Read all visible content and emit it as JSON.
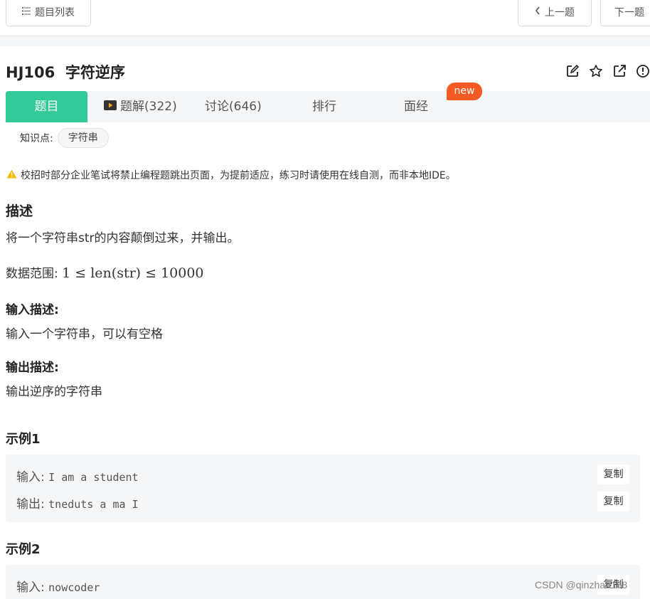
{
  "topbar": {
    "list_label": "题目列表",
    "prev_label": "上一题",
    "next_label": "下一题"
  },
  "problem": {
    "title": "HJ106  字符逆序"
  },
  "title_icons": [
    "edit-icon",
    "star-icon",
    "external-link-icon",
    "report-icon"
  ],
  "tabs": [
    {
      "label": "题目",
      "active": true
    },
    {
      "label": "题解(322)",
      "icon": "video-icon"
    },
    {
      "label": "讨论(646)"
    },
    {
      "label": "排行"
    },
    {
      "label": "面经",
      "badge": "new"
    }
  ],
  "knowledge": {
    "label": "知识点:",
    "tag": "字符串"
  },
  "warning": "校招时部分企业笔试将禁止编程题跳出页面，为提前适应，练习时请使用在线自测，而非本地IDE。",
  "description": {
    "heading": "描述",
    "text": "将一个字符串str的内容颠倒过来，并输出。",
    "range_label": "数据范围:",
    "range_formula": "1 ≤ len(str) ≤ 10000"
  },
  "input_desc": {
    "heading": "输入描述:",
    "text": "输入一个字符串，可以有空格"
  },
  "output_desc": {
    "heading": "输出描述:",
    "text": "输出逆序的字符串"
  },
  "examples": [
    {
      "heading": "示例1",
      "input_label": "输入:",
      "input": "I am a student",
      "output_label": "输出:",
      "output": "tneduts a ma I",
      "copy_label": "复制"
    },
    {
      "heading": "示例2",
      "input_label": "输入:",
      "input": "nowcoder",
      "copy_label": "复制"
    }
  ],
  "watermark": "CSDN @qinzhao168",
  "colors": {
    "accent": "#32ca99",
    "badge": "#f55a25",
    "warning": "#f5b800"
  }
}
